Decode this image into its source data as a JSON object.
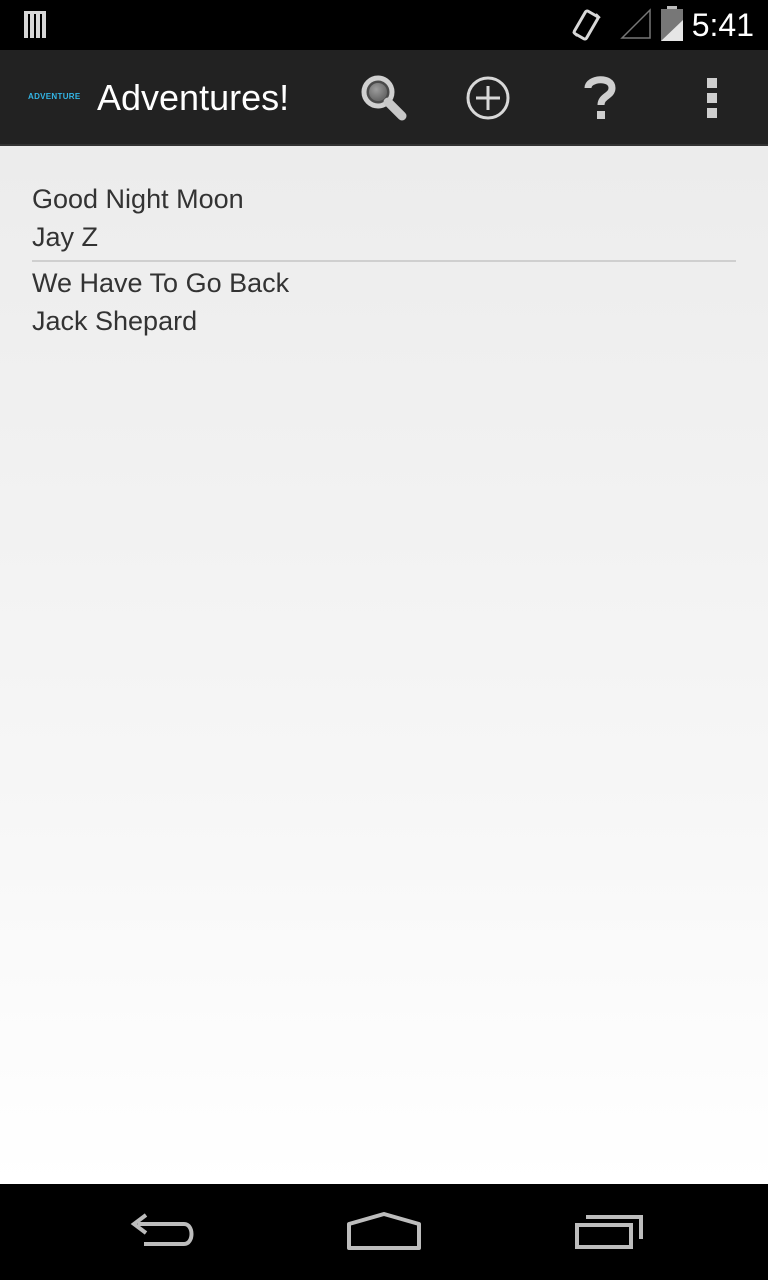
{
  "status_bar": {
    "time": "5:41",
    "icons": [
      "notification-icon",
      "vibrate-icon",
      "signal-icon",
      "battery-icon"
    ]
  },
  "action_bar": {
    "logo_text": "ADVENTURE",
    "title": "Adventures!",
    "actions": [
      "search-icon",
      "add-icon",
      "help-icon",
      "overflow-menu-icon"
    ]
  },
  "list": {
    "items": [
      {
        "title": "Good Night Moon",
        "subtitle": "Jay Z"
      },
      {
        "title": "We Have To Go Back",
        "subtitle": "Jack Shepard"
      }
    ]
  },
  "nav_bar": {
    "buttons": [
      "back-icon",
      "home-icon",
      "recents-icon"
    ]
  },
  "colors": {
    "action_bar_bg": "#222222",
    "accent": "#33b5e5",
    "list_text": "#333333",
    "divider": "#cfcfcf"
  }
}
